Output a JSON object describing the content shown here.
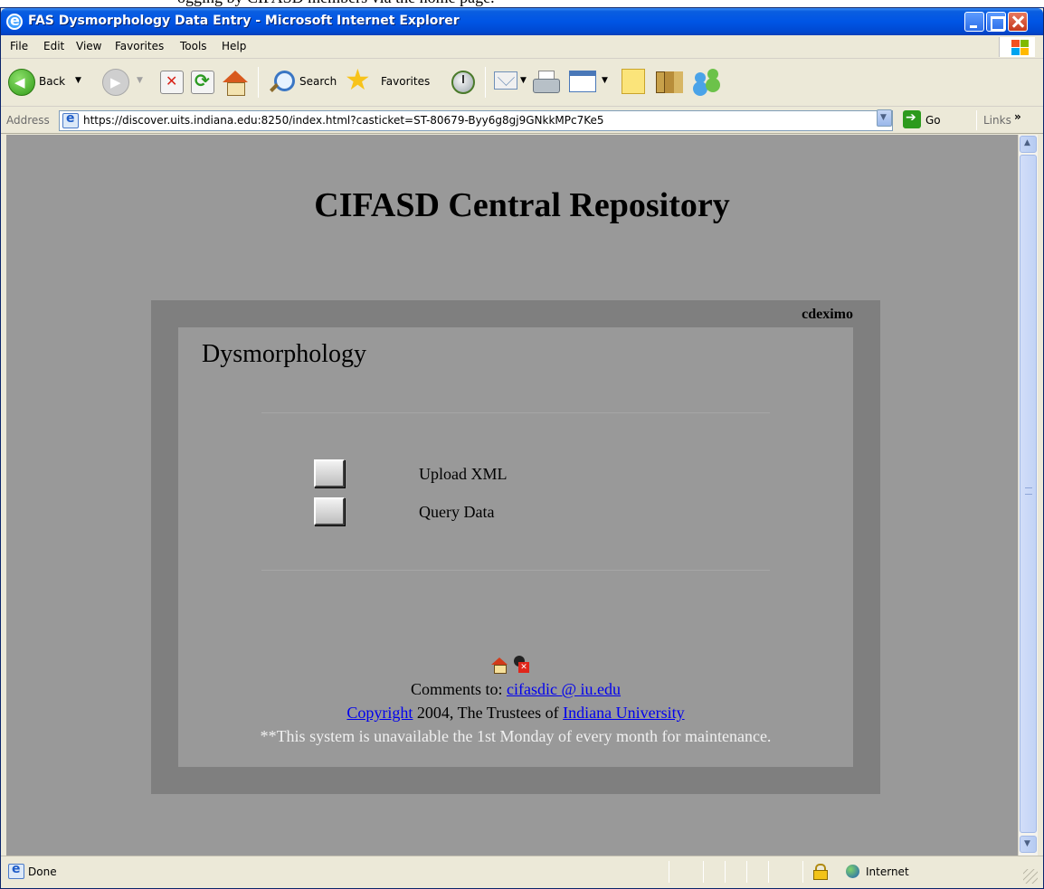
{
  "above_window_text": "ogging by CIFASD members via the home page.",
  "window": {
    "title": "FAS Dysmorphology Data Entry - Microsoft Internet Explorer",
    "title_color": "#0055e5"
  },
  "menu": {
    "items": [
      "File",
      "Edit",
      "View",
      "Favorites",
      "Tools",
      "Help"
    ]
  },
  "toolbar": {
    "back_label": "Back",
    "search_label": "Search",
    "favorites_label": "Favorites",
    "icons": [
      "back-icon",
      "forward-icon",
      "stop-icon",
      "refresh-icon",
      "home-icon",
      "search-icon",
      "favorites-icon",
      "history-icon",
      "mail-icon",
      "print-icon",
      "edit-icon",
      "notes-icon",
      "research-icon",
      "messenger-icon"
    ]
  },
  "address": {
    "label": "Address",
    "url": "https://discover.uits.indiana.edu:8250/index.html?casticket=ST-80679-Byy6g8gj9GNkkMPc7Ke5",
    "go_label": "Go",
    "links_label": "Links",
    "links_chevron": "»"
  },
  "page": {
    "title": "CIFASD Central Repository",
    "background": "#999999",
    "panel_color": "#7f7f7f",
    "username": "cdeximo",
    "section_title": "Dysmorphology",
    "actions": [
      {
        "label": "Upload XML"
      },
      {
        "label": "Query Data"
      }
    ],
    "footer": {
      "comments_prefix": "Comments to: ",
      "comments_email": "cifasdic @ iu.edu",
      "copyright_link": "Copyright",
      "copyright_middle": " 2004, The Trustees of ",
      "university_link": "Indiana University",
      "notice": "**This system is unavailable the 1st Monday of every month for maintenance.",
      "icons": [
        "home-icon",
        "logout-icon"
      ]
    }
  },
  "status": {
    "text": "Done",
    "zone": "Internet"
  }
}
